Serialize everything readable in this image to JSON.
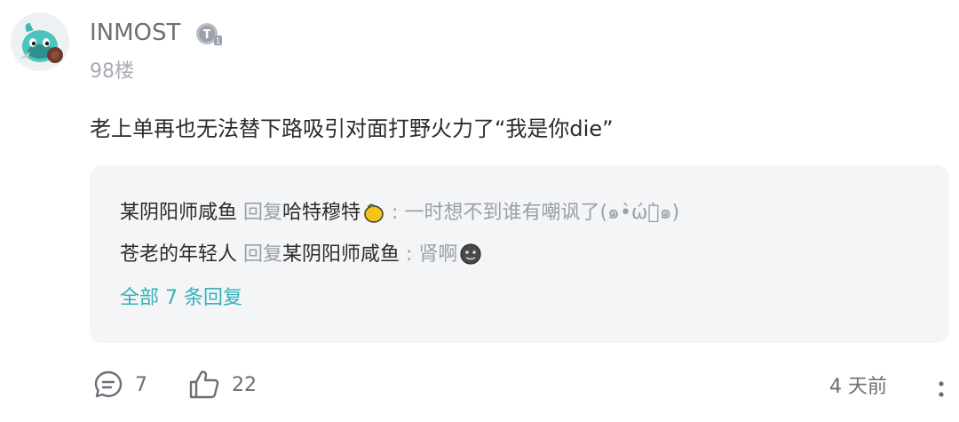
{
  "comment": {
    "username": "INMOST",
    "level_badge_icon": "level-t1-badge-icon",
    "floor": "98楼",
    "content": "老上单再也无法替下路吸引对面打野火力了“我是你die”"
  },
  "replies": [
    {
      "author": "某阴阳师咸鱼",
      "verb": "回复",
      "target": "哈特穆特",
      "target_icon": "lemon-icon",
      "separator": " : ",
      "text": "一时想不到谁有嘲讽了(๑•̀ώก̀๑)"
    },
    {
      "author": "苍老的年轻人",
      "verb": "回复",
      "target": "某阴阳师咸鱼",
      "separator": " : ",
      "text": "肾啊",
      "text_icon": "dark-face-emoji-icon"
    }
  ],
  "all_replies_label": "全部 7 条回复",
  "footer": {
    "comment_count": "7",
    "like_count": "22",
    "time": "4 天前"
  },
  "colors": {
    "accent": "#33b1b8",
    "muted": "#9aa0a6",
    "reply_bg": "#f4f5f7"
  }
}
